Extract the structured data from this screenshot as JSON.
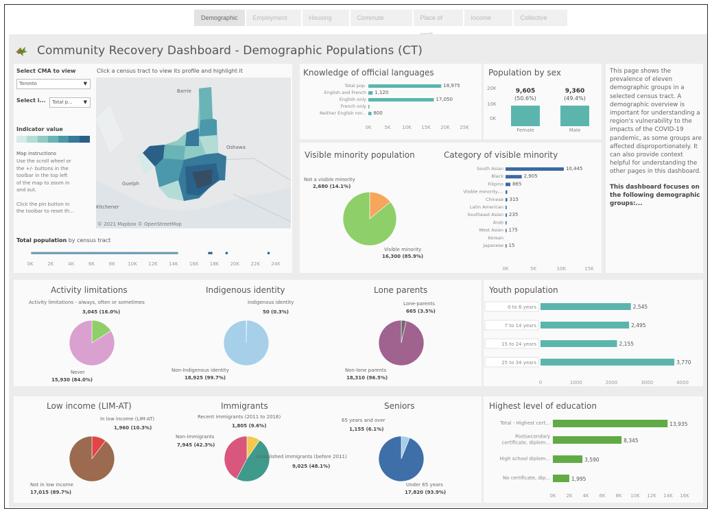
{
  "tabs": [
    {
      "label": "Demographic",
      "active": true
    },
    {
      "label": "Employment",
      "active": false
    },
    {
      "label": "Housing",
      "active": false
    },
    {
      "label": "Commute",
      "active": false
    },
    {
      "label": "Place of work",
      "active": false
    },
    {
      "label": "Income",
      "active": false
    },
    {
      "label": "Collective",
      "active": false
    }
  ],
  "header": {
    "title": "Community Recovery Dashboard - Demographic Populations (CT)",
    "logo_icon": "maple-leaf-icon"
  },
  "filters": {
    "cma_label": "Select CMA to view",
    "cma_value": "Toronto",
    "select_label": "Select i...",
    "select_value": "Total p...",
    "indicator_label": "Indicator value",
    "map_instructions_title": "Map instructions",
    "map_instructions": [
      "Use the scroll wheel or",
      "the +/- buttons in the",
      "toolbar in the top left",
      "of the map to zoom in",
      "and out.",
      "",
      "Click the pin button in",
      "the toolbar to reset th..."
    ]
  },
  "map": {
    "hint": "Click a census tract to view its profile and highlight it",
    "labels": {
      "barrie": "Barrie",
      "oshawa": "Oshawa",
      "guelph": "Guelph",
      "kitchener": "Kitchener"
    },
    "attribution": "© 2021 Mapbox © OpenStreetMap"
  },
  "total_population": {
    "title_bold": "Total population",
    "title_rest": " by census tract",
    "ticks": [
      "0K",
      "2K",
      "4K",
      "6K",
      "8K",
      "10K",
      "12K",
      "14K",
      "16K",
      "18K",
      "20K",
      "22K",
      "24K"
    ]
  },
  "official_languages": {
    "title": "Knowledge of official languages",
    "bars": [
      {
        "label": "Total pop.",
        "value": 18975,
        "text": "18,975"
      },
      {
        "label": "English and French",
        "value": 1120,
        "text": "1,120"
      },
      {
        "label": "English only",
        "value": 17050,
        "text": "17,050"
      },
      {
        "label": "French only",
        "value": 5,
        "text": ""
      },
      {
        "label": "Neither English nor...",
        "value": 800,
        "text": "800"
      }
    ],
    "ticks": [
      "0K",
      "5K",
      "10K",
      "15K",
      "20K",
      "25K"
    ]
  },
  "population_by_sex": {
    "title": "Population by sex",
    "female": {
      "label": "Female",
      "value": "9,605",
      "pct": "(50.6%)"
    },
    "male": {
      "label": "Male",
      "value": "9,360",
      "pct": "(49.4%)"
    },
    "ticks": [
      "20K",
      "10K",
      "0K"
    ]
  },
  "notes": {
    "paragraph": "This page shows the prevalence of eleven demographic groups in a selected census tract. A demographic overview is important for understanding a region's vulnerability to the impacts of the COVID-19 pandemic, as some groups are affected disproportionately. It can also provide context helpful for understanding the other pages in this dashboard.",
    "focus": "This dashboard focuses on the following demographic groups:..."
  },
  "visible_minority": {
    "title": "Visible minority population",
    "not_label": "Not a visible minority",
    "not_value": "2,680 (14.1%)",
    "vis_label": "Visible minority",
    "vis_value": "16,300 (85.9%)",
    "vis_pct": 85.9
  },
  "category_minority": {
    "title": "Category of visible minority",
    "bars": [
      {
        "label": "South Asian",
        "value": 10445,
        "text": "10,445"
      },
      {
        "label": "Black",
        "value": 2905,
        "text": "2,905"
      },
      {
        "label": "Filipino",
        "value": 865,
        "text": "865"
      },
      {
        "label": "Visible minority,...",
        "value": 300,
        "text": ""
      },
      {
        "label": "Chinese",
        "value": 315,
        "text": "315"
      },
      {
        "label": "Latin American",
        "value": 200,
        "text": ""
      },
      {
        "label": "Southeast Asian",
        "value": 235,
        "text": "235"
      },
      {
        "label": "Arab",
        "value": 150,
        "text": ""
      },
      {
        "label": "West Asian",
        "value": 175,
        "text": "175"
      },
      {
        "label": "Korean",
        "value": 0,
        "text": ""
      },
      {
        "label": "Japanese",
        "value": 15,
        "text": "15"
      }
    ],
    "ticks": [
      "0K",
      "5K",
      "10K",
      "15K"
    ]
  },
  "activity": {
    "title": "Activity limitations",
    "top_label": "Activity limitations - always, often or sometimes",
    "top_value": "3,045 (16.0%)",
    "bottom_label": "Never",
    "bottom_value": "15,930 (84.0%)",
    "pct": 16.0
  },
  "indigenous": {
    "title": "Indigenous identity",
    "top_label": "Indigenous identity",
    "top_value": "50 (0.3%)",
    "bottom_label": "Non-Indigenous identity",
    "bottom_value": "18,925 (99.7%)",
    "pct": 0.3
  },
  "lone_parents": {
    "title": "Lone parents",
    "top_label": "Lone-parents",
    "top_value": "665 (3.5%)",
    "bottom_label": "Non-lone parents",
    "bottom_value": "18,310 (96.5%)",
    "pct": 3.5
  },
  "youth": {
    "title": "Youth population",
    "bars": [
      {
        "label": "0 to 6 years",
        "value": 2545,
        "text": "2,545"
      },
      {
        "label": "7 to 14 years",
        "value": 2495,
        "text": "2,495"
      },
      {
        "label": "15 to 24 years",
        "value": 2155,
        "text": "2,155"
      },
      {
        "label": "25 to 34 years",
        "value": 3770,
        "text": "3,770"
      }
    ],
    "ticks": [
      "0",
      "1000",
      "2000",
      "3000",
      "4000"
    ]
  },
  "low_income": {
    "title": "Low income (LIM-AT)",
    "top_label": "In low income (LIM-AT)",
    "top_value": "1,960 (10.3%)",
    "bottom_label": "Not in low income",
    "bottom_value": "17,015 (89.7%)",
    "pct": 10.3
  },
  "immigrants": {
    "title": "Immigrants",
    "recent_label": "Recent immigrants (2011 to 2016)",
    "recent_value": "1,805 (9.6%)",
    "non_label": "Non-immigrants",
    "non_value": "7,945 (42.3%)",
    "est_label": "Established immigrants (before 2011)",
    "est_value": "9,025 (48.1%)"
  },
  "seniors": {
    "title": "Seniors",
    "top_label": "65 years and over",
    "top_value": "1,155 (6.1%)",
    "bottom_label": "Under 65 years",
    "bottom_value": "17,820 (93.9%)",
    "pct": 6.1
  },
  "education": {
    "title": "Highest level of education",
    "bars": [
      {
        "label": "Total - Highest cert...",
        "value": 13935,
        "text": "13,935"
      },
      {
        "label": "Postsecondary certificate, diplom...",
        "value": 8345,
        "text": "8,345"
      },
      {
        "label": "High school diplom...",
        "value": 3590,
        "text": "3,590"
      },
      {
        "label": "No certificate, dip...",
        "value": 1995,
        "text": "1,995"
      }
    ],
    "ticks": [
      "0K",
      "2K",
      "4K",
      "6K",
      "8K",
      "10K",
      "12K",
      "14K",
      "16K"
    ]
  },
  "colors": {
    "teal": "#5bb5ad",
    "navy": "#3b6aa0",
    "green": "#8fcf6a",
    "orange": "#f5a65b",
    "pink": "#d9a0d0",
    "lightblue": "#a6cfe9",
    "purple": "#a0628f",
    "brown": "#9b6a4f",
    "red": "#e24545",
    "edu_green": "#62aa45",
    "seniors_blue": "#3e6fa8"
  }
}
